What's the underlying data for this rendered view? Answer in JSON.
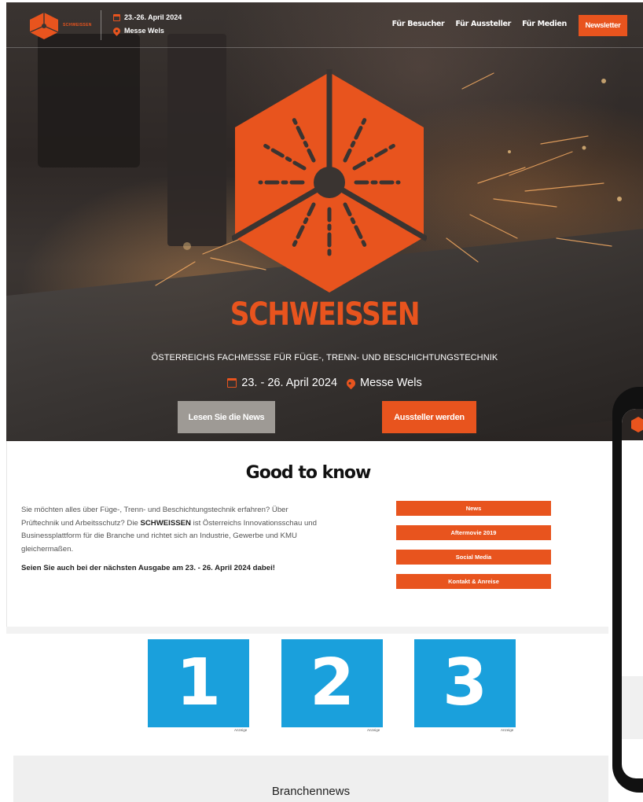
{
  "brand": {
    "name": "SCHWEISSEN",
    "logo_small_text": "SCHWEISSEN",
    "accent_color": "#e8541e"
  },
  "nav": {
    "date": "23.-26. April 2024",
    "location": "Messe Wels",
    "links": [
      "Für Besucher",
      "Für Aussteller",
      "Für Medien"
    ],
    "newsletter_label": "Newsletter"
  },
  "hero": {
    "tagline": "ÖSTERREICHS FACHMESSE FÜR FÜGE-, TRENN- UND BESCHICHTUNGSTECHNIK",
    "date": "23. - 26. April 2024",
    "location": "Messe Wels",
    "news_button": "Lesen Sie die News",
    "exhibitor_button": "Aussteller werden"
  },
  "good_to_know": {
    "title": "Good to know",
    "text_before": "Sie möchten alles über Füge-, Trenn- und Beschichtungstechnik erfahren? Über Prüftechnik und Arbeitsschutz? Die ",
    "text_bold": "SCHWEISSEN",
    "text_after": " ist Österreichs Innovationsschau und Businessplattform für die Branche und richtet sich an Industrie, Gewerbe und KMU gleichermaßen.",
    "cta": "Seien Sie auch bei der nächsten Ausgabe am 23. - 26. April 2024 dabei!",
    "buttons": [
      "News",
      "Aftermovie 2019",
      "Social Media",
      "Kontakt & Anreise"
    ]
  },
  "ads": [
    {
      "number": "1",
      "label": "Anzeige"
    },
    {
      "number": "2",
      "label": "Anzeige"
    },
    {
      "number": "3",
      "label": "Anzeige"
    }
  ],
  "branchennews": {
    "title": "Branchennews"
  }
}
